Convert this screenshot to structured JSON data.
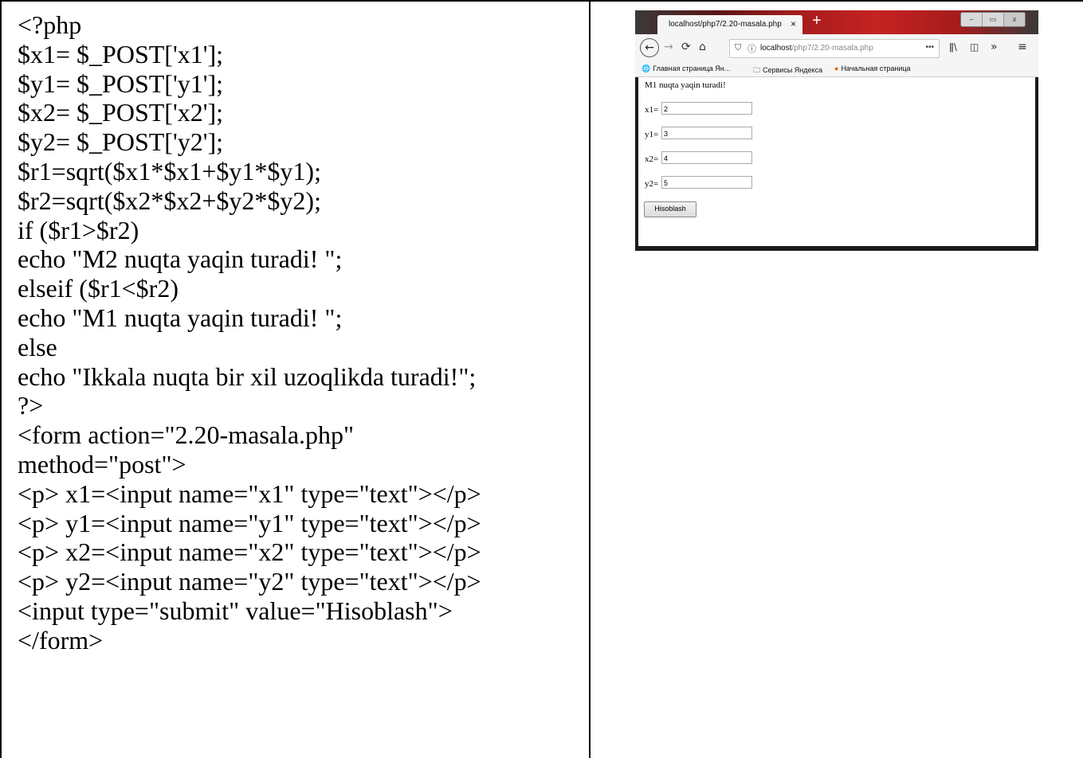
{
  "code_lines": [
    "<?php",
    "$x1= $_POST['x1'];",
    "$y1= $_POST['y1'];",
    "$x2= $_POST['x2'];",
    "$y2= $_POST['y2'];",
    "$r1=sqrt($x1*$x1+$y1*$y1);",
    "$r2=sqrt($x2*$x2+$y2*$y2);",
    "if ($r1>$r2)",
    "echo \"M2 nuqta yaqin turadi! \";",
    "elseif ($r1<$r2)",
    "echo \"M1 nuqta yaqin turadi! \";",
    "else",
    "echo \"Ikkala nuqta bir xil uzoqlikda turadi!\";",
    "?>",
    "<form action=\"2.20-masala.php\"",
    "method=\"post\">",
    "<p> x1=<input name=\"x1\" type=\"text\"></p>",
    "<p> y1=<input name=\"y1\" type=\"text\"></p>",
    "<p> x2=<input name=\"x2\" type=\"text\"></p>",
    "<p> y2=<input name=\"y2\" type=\"text\"></p>",
    "<input type=\"submit\" value=\"Hisoblash\">",
    "</form>"
  ],
  "browser": {
    "tab_title": "localhost/php7/2.20-masala.php",
    "tab_close": "×",
    "new_tab": "+",
    "window_controls": [
      "–",
      "▭",
      "x"
    ],
    "url_host": "localhost",
    "url_path": "/php7/2.20-masala.php",
    "url_menu": "•••",
    "bookmarks": [
      {
        "icon": "globe-icon",
        "label": "Главная страница Ян..."
      },
      {
        "icon": "folder-icon",
        "label": "Сервисы Яндекса"
      },
      {
        "icon": "firefox-icon",
        "label": "Начальная страница"
      }
    ],
    "page": {
      "result": "M1 nuqta yaqin turadi!",
      "fields": [
        {
          "label": "x1=",
          "value": "2"
        },
        {
          "label": "y1=",
          "value": "3"
        },
        {
          "label": "x2=",
          "value": "4"
        },
        {
          "label": "y2=",
          "value": "5"
        }
      ],
      "submit_label": "Hisoblash"
    }
  }
}
